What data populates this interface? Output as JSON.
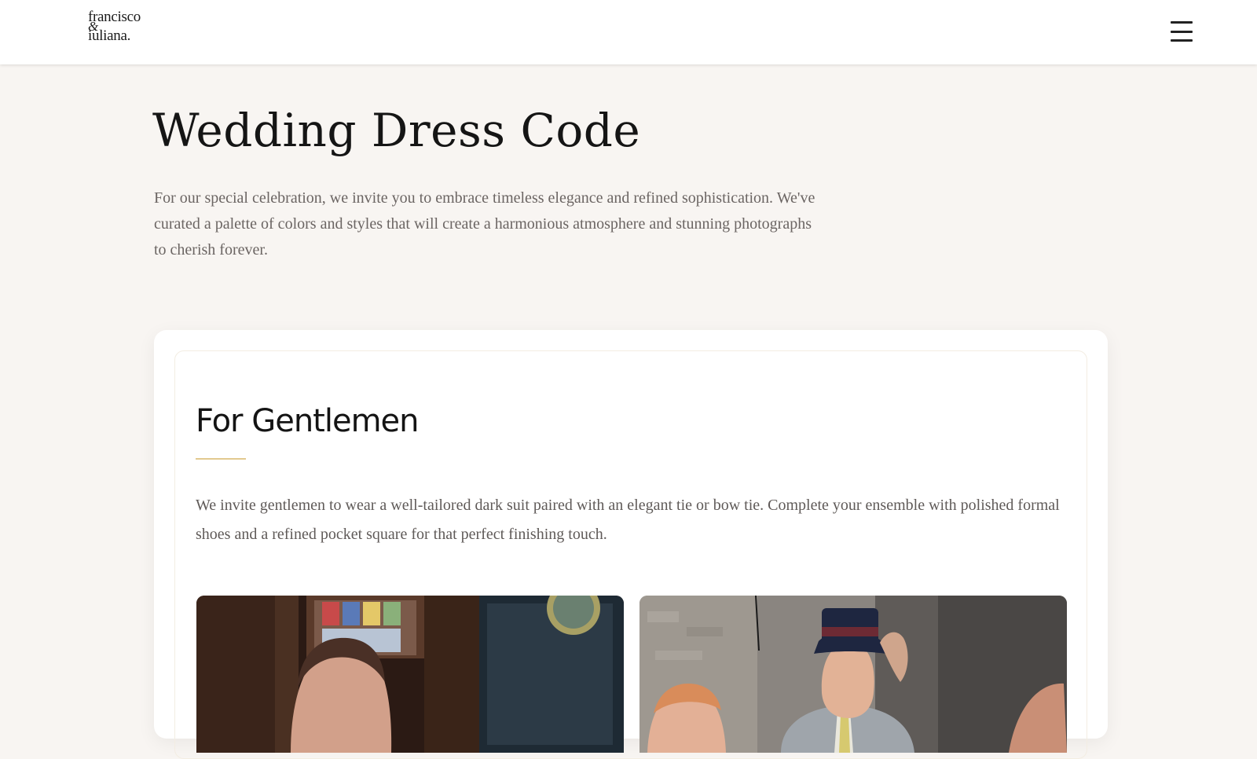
{
  "header": {
    "logo": {
      "line1": "francisco",
      "line2": "&",
      "line3": "iuliana."
    },
    "menu_icon": "hamburger-menu-icon"
  },
  "hero": {
    "title": "Wedding Dress Code",
    "intro": "For our special celebration, we invite you to embrace timeless elegance and refined sophistication. We've curated a palette of colors and styles that will create a harmonious atmosphere and stunning photographs to cherish forever."
  },
  "gentlemen": {
    "title": "For Gentlemen",
    "text": "We invite gentlemen to wear a well-tailored dark suit paired with an elegant tie or bow tie. Complete your ensemble with polished formal shoes and a refined pocket square for that perfect finishing touch."
  },
  "colors": {
    "background": "#f8f5f2",
    "accent": "#e2c98f",
    "body_text": "#6b6563"
  }
}
